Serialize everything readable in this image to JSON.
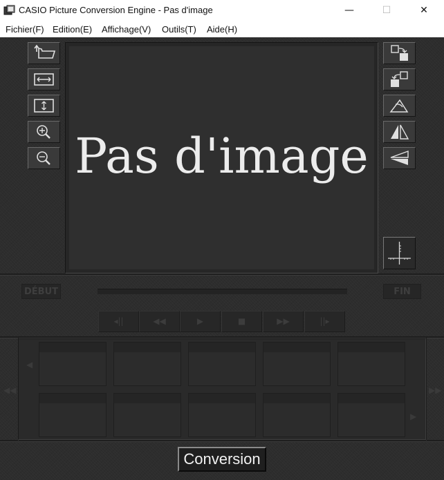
{
  "window": {
    "title": "CASIO Picture Conversion Engine - Pas d'image",
    "minimize_glyph": "—",
    "maximize_glyph": "☐",
    "close_glyph": "✕"
  },
  "menu": {
    "items": [
      {
        "label": "Fichier(F)"
      },
      {
        "label": "Edition(E)"
      },
      {
        "label": "Affichage(V)"
      },
      {
        "label": "Outils(T)"
      },
      {
        "label": "Aide(H)"
      }
    ]
  },
  "left_tools": [
    {
      "icon": "open-folder-icon"
    },
    {
      "icon": "fit-width-icon"
    },
    {
      "icon": "fit-height-icon"
    },
    {
      "icon": "zoom-in-icon"
    },
    {
      "icon": "zoom-out-icon"
    }
  ],
  "right_tools": [
    {
      "icon": "rotate-right-icon"
    },
    {
      "icon": "rotate-left-icon"
    },
    {
      "icon": "angle-adjust-icon"
    },
    {
      "icon": "flip-horizontal-icon"
    },
    {
      "icon": "flip-vertical-icon"
    }
  ],
  "viewer": {
    "placeholder": "Pas d'image"
  },
  "playback": {
    "start_label": "DÉBUT",
    "end_label": "FIN",
    "progress": 0,
    "controls": [
      {
        "glyph": "◂||"
      },
      {
        "glyph": "◀◀"
      },
      {
        "glyph": "▶"
      },
      {
        "glyph": "■"
      },
      {
        "glyph": "▶▶"
      },
      {
        "glyph": "||▸"
      }
    ]
  },
  "thumbnails": {
    "prev_glyph": "◀◀",
    "next_glyph": "▶▶",
    "scroll_up_glyph": "◀",
    "scroll_down_glyph": "▶"
  },
  "actions": {
    "conversion_label": "Conversion"
  },
  "colors": {
    "panel": "#2d2d2d",
    "viewer_bg": "#2f2f2f",
    "placeholder_text": "#ececec"
  }
}
